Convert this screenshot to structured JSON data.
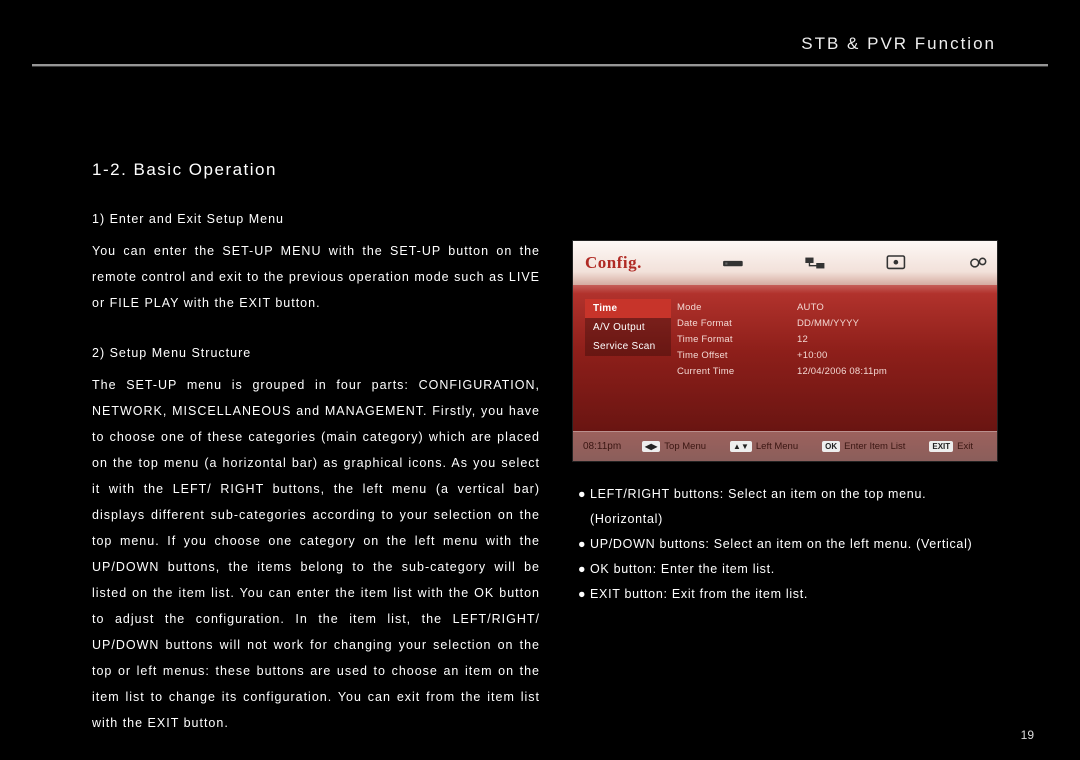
{
  "header": {
    "title": "STB & PVR Function"
  },
  "section": {
    "title": "1-2. Basic Operation",
    "sub1": "1) Enter and Exit Setup Menu",
    "para1": "You can enter the SET-UP MENU with the SET-UP button on the remote control and exit to the previous operation mode such as LIVE or FILE PLAY with the EXIT button.",
    "sub2": "2) Setup Menu Structure",
    "para2": "The SET-UP menu is grouped in four parts: CONFIGURATION, NETWORK, MISCELLANEOUS and MANAGEMENT. Firstly, you have to choose one of these categories (main category) which are placed on the top menu (a horizontal bar) as graphical icons. As you select it with the LEFT/ RIGHT buttons, the left menu (a vertical bar) displays different sub-categories according to your selection on the top menu. If you choose one category on the left menu with the UP/DOWN buttons, the items belong to the sub-category will be listed on the item list. You can enter the item list with the OK button to adjust the configuration. In the item list, the LEFT/RIGHT/ UP/DOWN buttons will not work for changing your selection on the top or left menus: these buttons are used to choose an item on the item list to change its configuration. You can exit from the item list with the EXIT button."
  },
  "bullets": [
    "LEFT/RIGHT buttons: Select an item on the top menu. (Horizontal)",
    "UP/DOWN buttons: Select an item on the left menu. (Vertical)",
    "OK button: Enter the item list.",
    "EXIT button: Exit from the item list."
  ],
  "screenshot": {
    "logo": "Config.",
    "left_menu": [
      "Time",
      "A/V Output",
      "Service Scan"
    ],
    "left_selected_index": 0,
    "rows": [
      {
        "k": "Mode",
        "v": "AUTO"
      },
      {
        "k": "Date Format",
        "v": "DD/MM/YYYY"
      },
      {
        "k": "Time Format",
        "v": "12"
      },
      {
        "k": "Time Offset",
        "v": "+10:00"
      },
      {
        "k": "Current Time",
        "v": "12/04/2006 08:11pm"
      }
    ],
    "clock": "08:11pm",
    "hints": {
      "lr_badge": "◀▶",
      "lr_text": "Top Menu",
      "ud_badge": "▲▼",
      "ud_text": "Left Menu",
      "ok_badge": "OK",
      "ok_text": "Enter Item List",
      "exit_badge": "EXIT",
      "exit_text": "Exit"
    }
  },
  "page_number": "19"
}
